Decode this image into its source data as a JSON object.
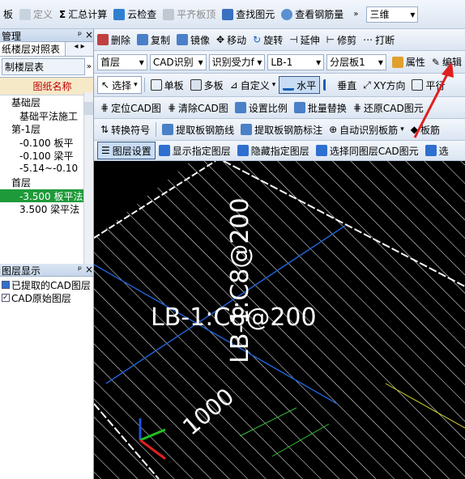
{
  "menubar": {
    "items": [
      "板",
      "定义",
      "汇总计算",
      "云检查",
      "平齐板顶",
      "查找图元",
      "查看钢筋量"
    ],
    "view_mode": "三维"
  },
  "left_panel": {
    "title": "管理",
    "tab": "纸楼层对照表",
    "sub_button": "制楼层表",
    "header": "图纸名称",
    "rows": [
      {
        "text": "基础层",
        "type": "group"
      },
      {
        "text": "基础平法施工",
        "type": "item"
      },
      {
        "text": "第-1层",
        "type": "group"
      },
      {
        "text": "-0.100 板平",
        "type": "item"
      },
      {
        "text": "-0.100 梁平",
        "type": "item"
      },
      {
        "text": "-5.14~-0.10",
        "type": "item"
      },
      {
        "text": "首层",
        "type": "group"
      },
      {
        "text": "-3.500 板平法",
        "type": "selected"
      },
      {
        "text": "3.500 梁平法",
        "type": "item"
      }
    ]
  },
  "layer_panel": {
    "title": "图层显示",
    "items": [
      "已提取的CAD图层",
      "CAD原始图层"
    ]
  },
  "toolbar1": {
    "items": [
      "删除",
      "复制",
      "镜像",
      "移动",
      "旋转",
      "延伸",
      "修剪",
      "打断"
    ]
  },
  "toolbar2": {
    "floor": "首层",
    "cad": "CAD识别",
    "recog": "识别受力f",
    "comp": "LB-1",
    "layer": "分层板1",
    "attr": "属性",
    "edit": "编辑"
  },
  "toolbar3": {
    "items": [
      "选择",
      "单板",
      "多板",
      "自定义",
      "水平",
      "垂直",
      "XY方向",
      "平行"
    ]
  },
  "toolbar4": {
    "items": [
      "定位CAD图",
      "清除CAD图",
      "设置比例",
      "批量替换",
      "还原CAD图元"
    ]
  },
  "toolbar5": {
    "items": [
      "转换符号",
      "提取板钢筋线",
      "提取板钢筋标注",
      "自动识别板筋",
      "板筋"
    ]
  },
  "toolbar6": {
    "items": [
      "图层设置",
      "显示指定图层",
      "隐藏指定图层",
      "选择同图层CAD图元",
      "选"
    ]
  },
  "canvas": {
    "label_h": "LB-1:C8@200",
    "label_v": "LB-1:C8@200",
    "dim": "1000"
  },
  "colors": {
    "accent_red": "#e02020",
    "canvas_bg": "#000000",
    "selected_row": "#1e9a3a",
    "header_text": "#c00000"
  }
}
